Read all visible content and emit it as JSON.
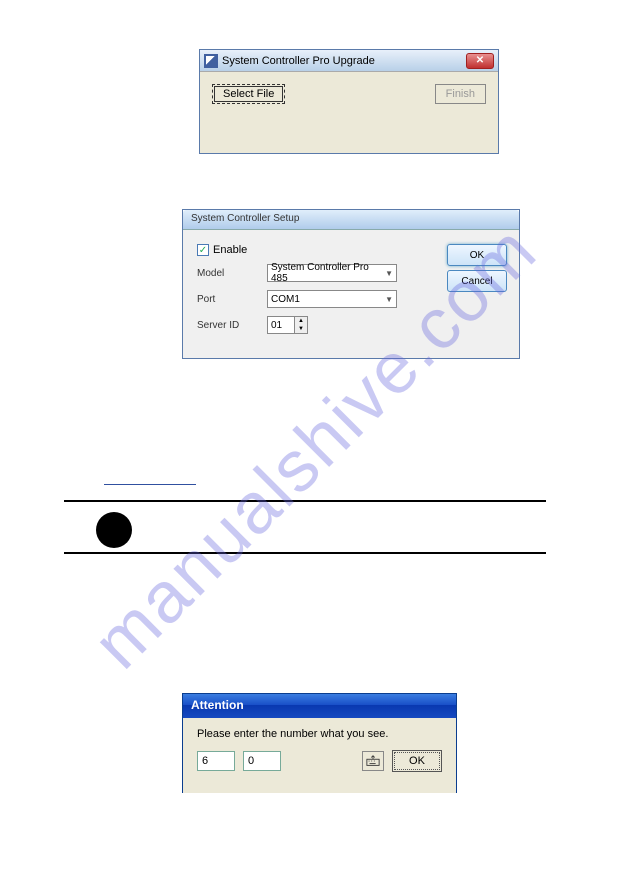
{
  "watermark": "manualshive.com",
  "dialog1": {
    "title": "System Controller Pro Upgrade",
    "select_file": "Select File",
    "finish": "Finish",
    "close_icon": "x-icon"
  },
  "dialog2": {
    "title": "System Controller Setup",
    "enable_label": "Enable",
    "enable_checked": true,
    "model_label": "Model",
    "model_value": "System Controller Pro 485",
    "port_label": "Port",
    "port_value": "COM1",
    "serverid_label": "Server ID",
    "serverid_value": "01",
    "ok": "OK",
    "cancel": "Cancel"
  },
  "dialog3": {
    "title": "Attention",
    "prompt": "Please enter the number what you see.",
    "value1": "6",
    "value2": "0",
    "ok": "OK"
  }
}
